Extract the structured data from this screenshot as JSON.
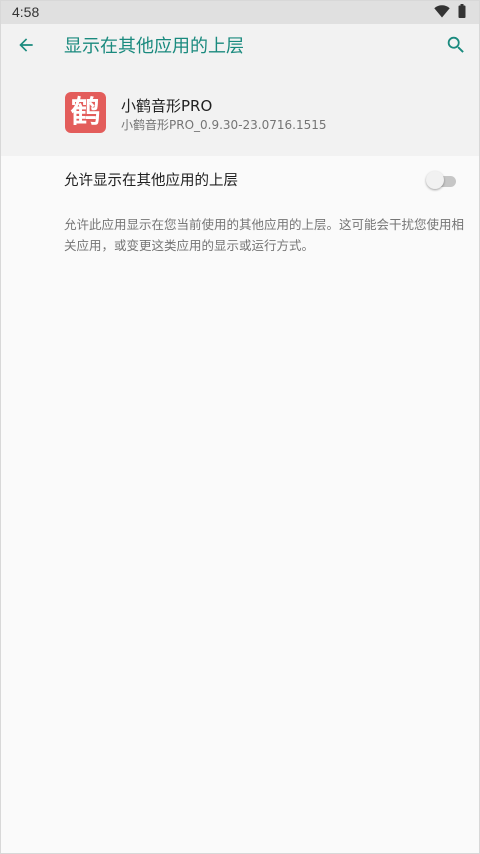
{
  "status_bar": {
    "time": "4:58",
    "icons": [
      "wifi-icon",
      "battery-icon"
    ]
  },
  "app_bar": {
    "title": "显示在其他应用的上层",
    "back_icon": "arrow-back-icon",
    "search_icon": "search-icon"
  },
  "app_header": {
    "app_name": "小鹤音形PRO",
    "version": "小鹤音形PRO_0.9.30-23.0716.1515",
    "icon_glyph": "鹤",
    "icon_color": "#e35d5b"
  },
  "setting": {
    "label": "允许显示在其他应用的上层",
    "enabled": false
  },
  "description": "允许此应用显示在您当前使用的其他应用的上层。这可能会干扰您使用相关应用，或变更这类应用的显示或运行方式。",
  "colors": {
    "accent": "#1a8a7e",
    "header_bg": "#f2f2f2",
    "page_bg": "#fafafa",
    "status_bar_bg": "#e0e0e0"
  }
}
